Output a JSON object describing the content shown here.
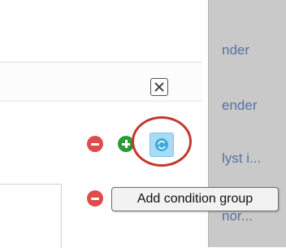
{
  "side_panel": {
    "items": [
      {
        "label": "nder"
      },
      {
        "label": "ender"
      },
      {
        "label": "lyst i..."
      },
      {
        "label": "nor..."
      }
    ]
  },
  "tooltip": {
    "text": "Add condition group"
  },
  "icons": {
    "close": "close-icon",
    "remove": "minus-icon",
    "add": "plus-icon",
    "group": "refresh-icon"
  },
  "colors": {
    "remove": "#df4c4b",
    "add": "#2c9a35",
    "group_button": "#a9dcf2",
    "highlight": "#c03a2b",
    "link": "#5472a4"
  }
}
